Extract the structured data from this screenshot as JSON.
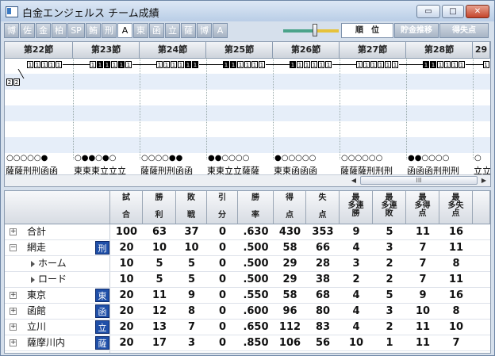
{
  "window": {
    "title": "白金エンジェルス チーム成績",
    "buttons": {
      "minimize": "▭",
      "maximize": "□",
      "close": "✕"
    }
  },
  "toolbar": {
    "tabs": [
      "博",
      "佐",
      "金",
      "柏",
      "SP",
      "鮪",
      "刑",
      "A",
      "東",
      "函",
      "立",
      "薩",
      "博",
      "A"
    ],
    "selected_index": 7,
    "slider_level": 0.57,
    "buttons": [
      {
        "label": "順　位",
        "active": true
      },
      {
        "label": "貯金推移",
        "active": false
      },
      {
        "label": "得失点",
        "active": false
      }
    ]
  },
  "chart": {
    "sections": [
      "第22節",
      "第23節",
      "第24節",
      "第25節",
      "第26節",
      "第27節",
      "第28節",
      "29"
    ],
    "rank_chips": [
      "2",
      "2"
    ],
    "section_chips": [
      [
        "1",
        "1",
        "1",
        "1",
        "1"
      ],
      [
        "1",
        "1",
        "1",
        "1",
        "1",
        "1"
      ],
      [
        "1",
        "1",
        "1",
        "1",
        "1",
        "1"
      ],
      [
        "1",
        "1",
        "1",
        "1",
        "1",
        "1"
      ],
      [
        "1",
        "1",
        "1",
        "1",
        "1",
        "1"
      ],
      [
        "1",
        "1",
        "1",
        "1",
        "1",
        "1"
      ],
      [
        "1",
        "1",
        "1",
        "1",
        "1",
        "1"
      ],
      [
        "1"
      ]
    ],
    "results": [
      "○○○○○●",
      "○●●○●○",
      "○○○○●●",
      "●●○○○○",
      "●○○○○○",
      "○○○○○○",
      "●●○○○○",
      "○"
    ],
    "opponents": [
      "薩薩刑刑函函",
      "東東東立立立",
      "薩薩刑刑函函",
      "東東立立薩薩",
      "東東函函函",
      "薩薩薩刑刑刑",
      "函函函刑刑刑",
      "立立"
    ],
    "scrollbar_grip": "III",
    "scroll_left": "◀",
    "scroll_right": "▶"
  },
  "table": {
    "headers": [
      [
        "試",
        "合"
      ],
      [
        "勝",
        "利"
      ],
      [
        "敗",
        "戦"
      ],
      [
        "引",
        "分"
      ],
      [
        "勝",
        "率"
      ],
      [
        "得",
        "点"
      ],
      [
        "失",
        "点"
      ],
      [
        "最",
        "多連",
        "勝"
      ],
      [
        "最",
        "多連",
        "敗"
      ],
      [
        "最",
        "多得",
        "点"
      ],
      [
        "最",
        "多失",
        "点"
      ]
    ],
    "expander_expanded": "−",
    "expander_collapsed": "+",
    "rows": [
      {
        "name": "合計",
        "badge": "",
        "sub": false,
        "expander": "+",
        "values": [
          "100",
          "63",
          "37",
          "0",
          ".630",
          "430",
          "353",
          "9",
          "5",
          "11",
          "16"
        ]
      },
      {
        "name": "網走",
        "badge": "刑",
        "sub": false,
        "expander": "−",
        "values": [
          "20",
          "10",
          "10",
          "0",
          ".500",
          "58",
          "66",
          "4",
          "3",
          "7",
          "11"
        ]
      },
      {
        "name": "ホーム",
        "badge": "",
        "sub": true,
        "expander": "",
        "values": [
          "10",
          "5",
          "5",
          "0",
          ".500",
          "29",
          "28",
          "3",
          "2",
          "7",
          "8"
        ]
      },
      {
        "name": "ロード",
        "badge": "",
        "sub": true,
        "expander": "",
        "values": [
          "10",
          "5",
          "5",
          "0",
          ".500",
          "29",
          "38",
          "2",
          "2",
          "7",
          "11"
        ]
      },
      {
        "name": "東京",
        "badge": "東",
        "sub": false,
        "expander": "+",
        "values": [
          "20",
          "11",
          "9",
          "0",
          ".550",
          "58",
          "68",
          "4",
          "5",
          "9",
          "16"
        ]
      },
      {
        "name": "函館",
        "badge": "函",
        "sub": false,
        "expander": "+",
        "values": [
          "20",
          "12",
          "8",
          "0",
          ".600",
          "96",
          "80",
          "4",
          "3",
          "10",
          "8"
        ]
      },
      {
        "name": "立川",
        "badge": "立",
        "sub": false,
        "expander": "+",
        "values": [
          "20",
          "13",
          "7",
          "0",
          ".650",
          "112",
          "83",
          "4",
          "2",
          "11",
          "10"
        ]
      },
      {
        "name": "薩摩川内",
        "badge": "薩",
        "sub": false,
        "expander": "+",
        "values": [
          "20",
          "17",
          "3",
          "0",
          ".850",
          "106",
          "56",
          "10",
          "1",
          "11",
          "7"
        ]
      }
    ]
  }
}
